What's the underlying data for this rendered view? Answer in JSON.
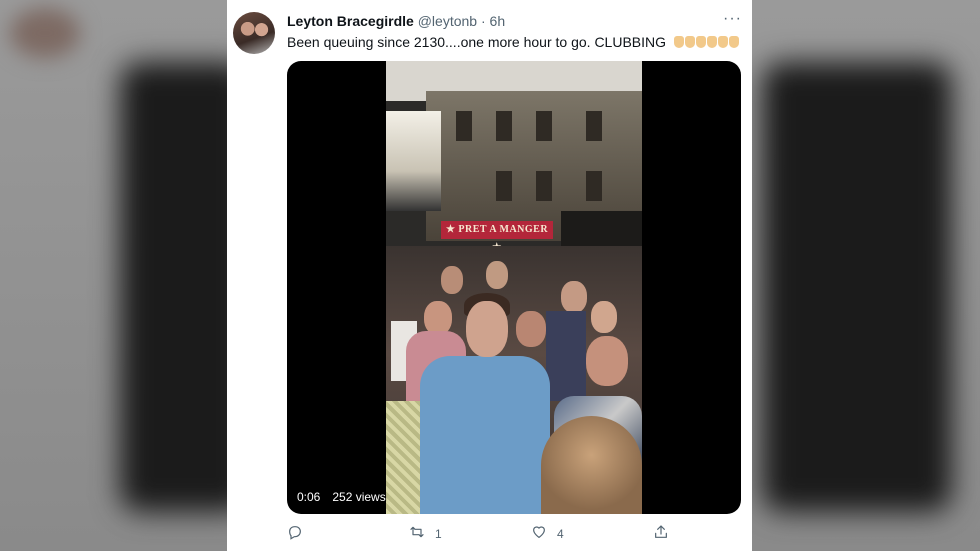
{
  "tweet": {
    "author_name": "Leyton Bracegirdle",
    "author_handle": "@leytonb",
    "separator": "·",
    "time": "6h",
    "more_label": "···",
    "text": "Been queuing since 2130....one more hour to go. CLUBBING",
    "emoji_count": 6
  },
  "video": {
    "duration": "0:06",
    "views": "252 views",
    "sign_text": "★ PRET A MANGER ★"
  },
  "actions": {
    "reply_icon": "reply-icon",
    "retweet_count": "1",
    "like_count": "4",
    "share_icon": "share-icon"
  },
  "colors": {
    "text_primary": "#0f1419",
    "text_secondary": "#536471",
    "card_bg": "#ffffff"
  }
}
